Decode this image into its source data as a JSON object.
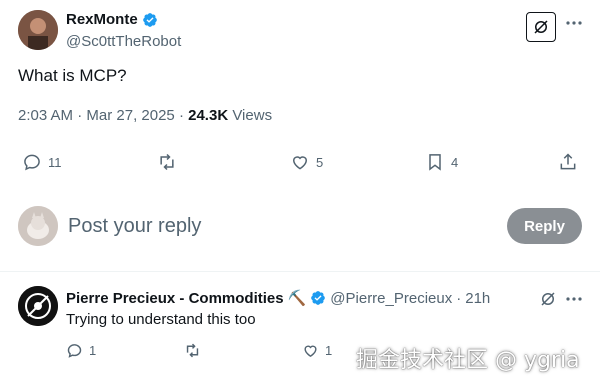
{
  "tweet": {
    "author_name": "RexMonte",
    "author_handle": "@Sc0ttTheRobot",
    "text": "What is MCP?",
    "time": "2:03 AM",
    "sep1": " · ",
    "date": "Mar 27, 2025",
    "sep2": " · ",
    "views_count": "24.3K",
    "views_label": " Views",
    "replies": "11",
    "retweets": "",
    "likes": "5",
    "bookmarks": "4"
  },
  "compose": {
    "placeholder": "Post your reply",
    "button": "Reply"
  },
  "reply": {
    "author_name": "Pierre Precieux - Commodities",
    "emoji": "⛏️",
    "author_handle": "@Pierre_Precieux",
    "dot": "·",
    "time": "21h",
    "text": "Trying to understand this too",
    "replies": "1",
    "retweets": "",
    "likes": "1"
  },
  "watermark": "掘金技术社区 @ ygria",
  "colors": {
    "verified": "#1d9bf0",
    "muted": "#536471",
    "reply_button": "#8a8f94"
  }
}
